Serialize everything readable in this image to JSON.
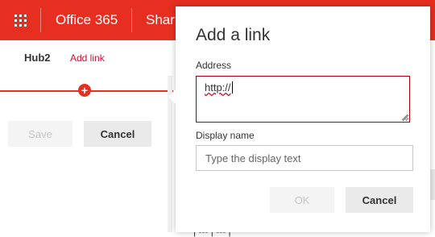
{
  "suite_bar": {
    "app_name": "Office 365",
    "site_name": "Shar",
    "background_color": "#e62f20",
    "waffle_icon": "waffle-grid-icon"
  },
  "subnav": {
    "hub_name": "Hub2",
    "add_link_label": "Add link"
  },
  "page_actions": {
    "save_label": "Save",
    "cancel_label": "Cancel"
  },
  "background_text": "| --- | --- |",
  "dialog": {
    "title": "Add a link",
    "address_label": "Address",
    "address_value": "http://",
    "display_name_label": "Display name",
    "display_name_placeholder": "Type the display text",
    "ok_label": "OK",
    "cancel_label": "Cancel",
    "error_border_color": "#a80000"
  },
  "insert_icon": "plus-circle-icon"
}
